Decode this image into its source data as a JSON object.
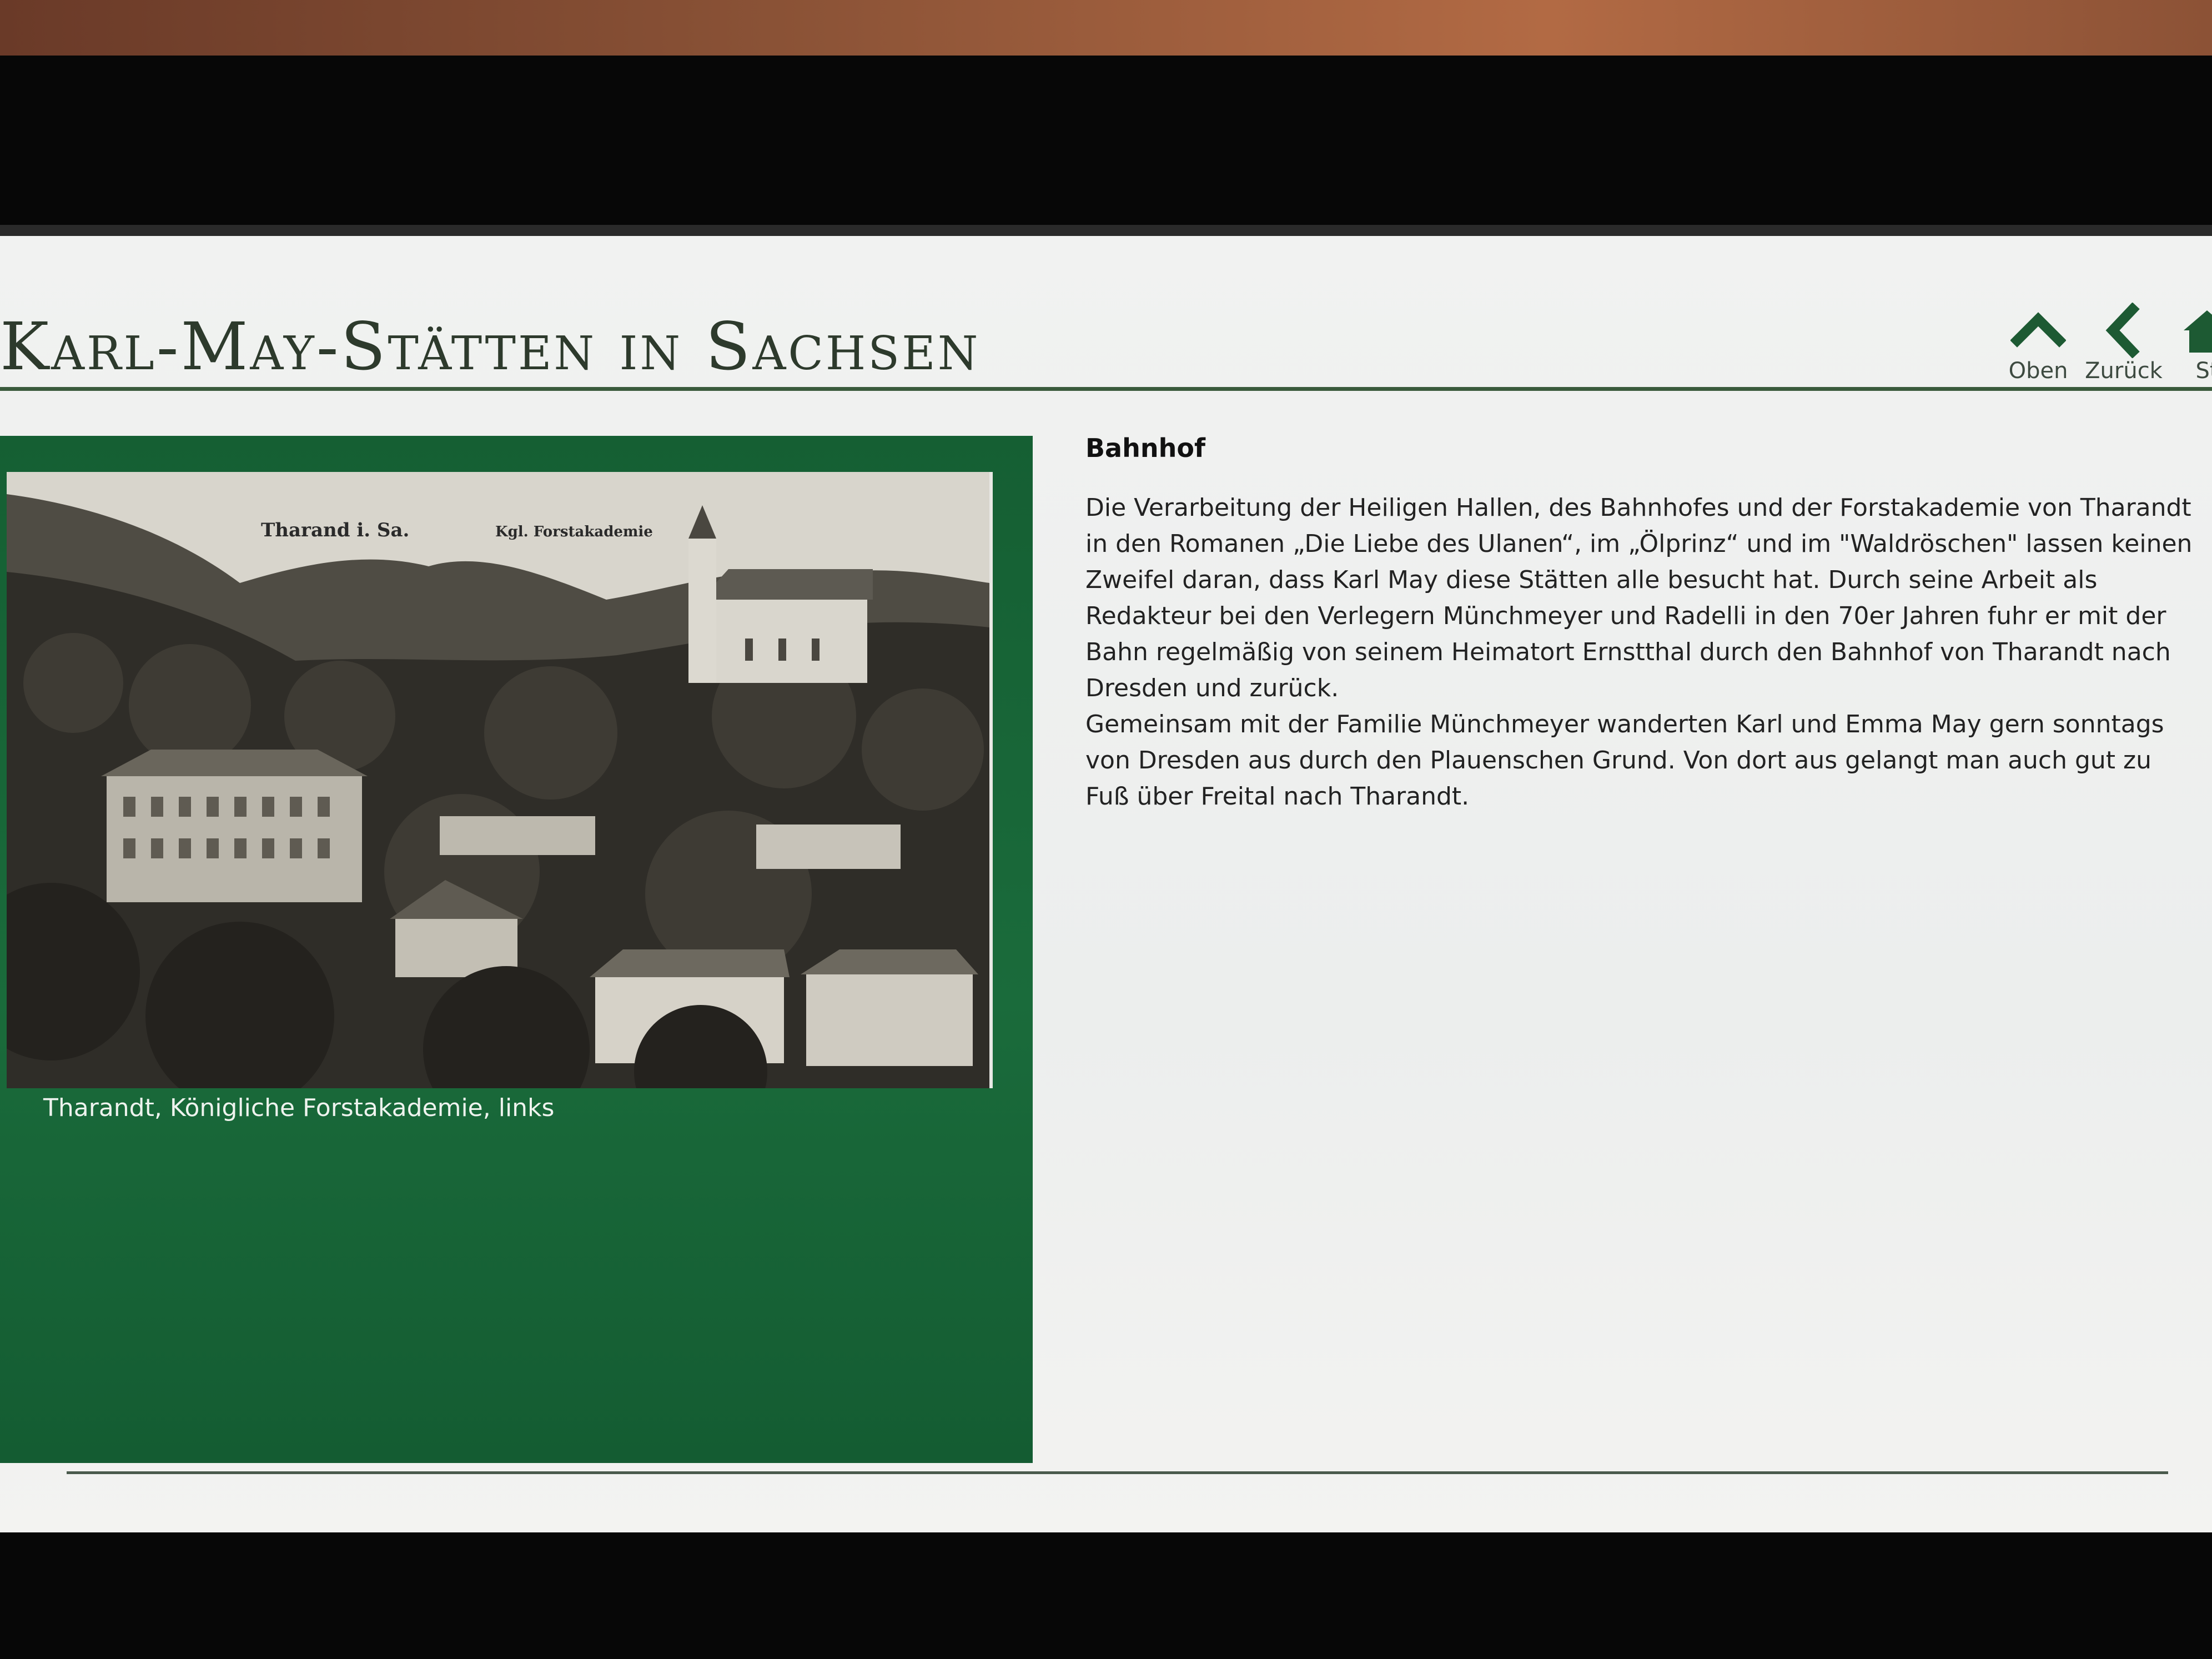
{
  "header": {
    "title": "Karl-May-Stätten in Sachsen"
  },
  "nav": {
    "up_label": "Oben",
    "up_icon": "chevron-up-icon",
    "back_label": "Zurück",
    "back_icon": "chevron-left-icon",
    "start_label": "St",
    "start_icon": "home-icon"
  },
  "image": {
    "caption": "Tharandt, Königliche Forstakademie, links",
    "inscription_place": "Tharand i. Sa.",
    "inscription_building": "Kgl. Forstakademie"
  },
  "article": {
    "heading": "Bahnhof",
    "paragraph1": "Die Verarbeitung der Heiligen Hallen, des Bahnhofes und der Forstakademie von Tharandt in den Romanen „Die Liebe des Ulanen“, im „Ölprinz“ und im \"Waldröschen\" lassen keinen Zweifel daran, dass Karl May diese Stätten alle besucht hat. Durch seine Arbeit als Redakteur bei den Verlegern Münchmeyer und Radelli in den 70er Jahren fuhr er mit der Bahn regelmäßig von seinem Heimatort Ernstthal durch den Bahnhof von Tharandt nach Dresden und zurück.",
    "paragraph2": "Gemeinsam mit der Familie Münchmeyer wanderten Karl und Emma May gern sonntags von Dresden aus durch den Plauenschen Grund. Von dort aus gelangt man auch gut zu Fuß über Freital nach Tharandt."
  },
  "colors": {
    "accent_green": "#1a6b3b",
    "title_text": "#2d3a2c",
    "nav_icon": "#1d5a33"
  }
}
